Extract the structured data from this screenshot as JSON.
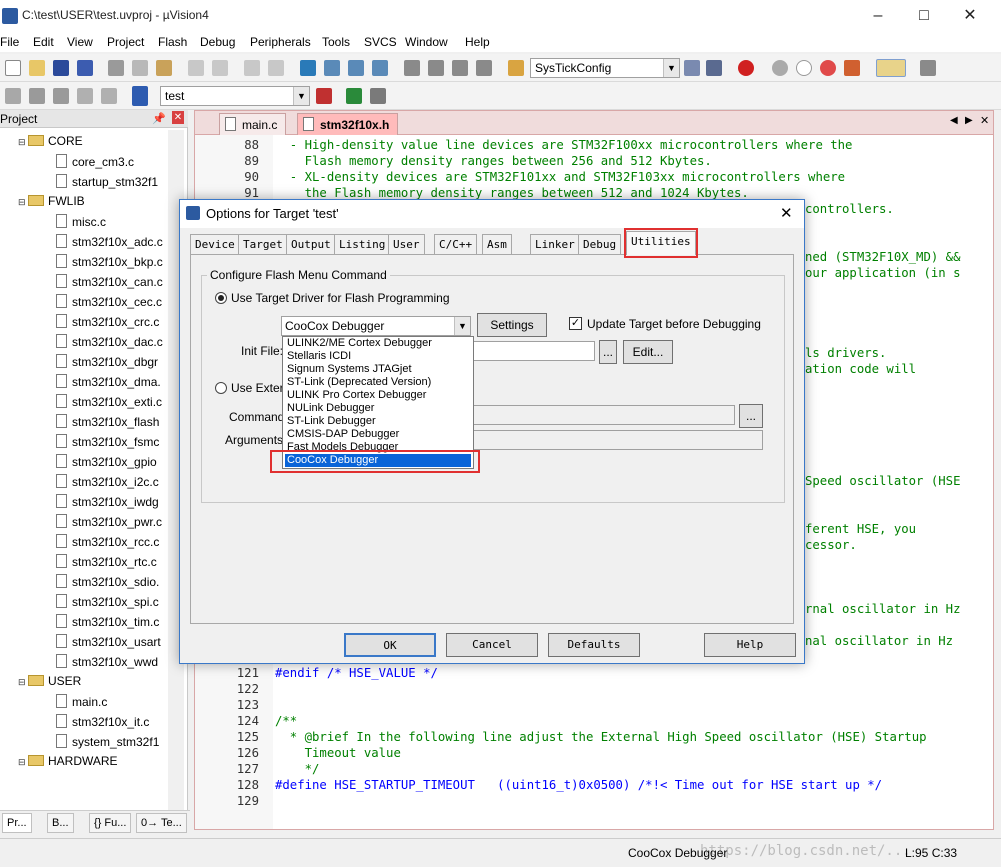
{
  "window": {
    "title": "C:\\test\\USER\\test.uvproj - µVision4"
  },
  "menu": [
    "File",
    "Edit",
    "View",
    "Project",
    "Flash",
    "Debug",
    "Peripherals",
    "Tools",
    "SVCS",
    "Window",
    "Help"
  ],
  "toolbar1": {
    "function_combo": "SysTickConfig"
  },
  "toolbar2": {
    "target_combo": "test"
  },
  "project_panel": {
    "title": "Project",
    "tree": [
      {
        "type": "folder",
        "label": "CORE"
      },
      {
        "type": "file",
        "label": "core_cm3.c"
      },
      {
        "type": "file",
        "label": "startup_stm32f1"
      },
      {
        "type": "folder",
        "label": "FWLIB"
      },
      {
        "type": "file",
        "label": "misc.c"
      },
      {
        "type": "file",
        "label": "stm32f10x_adc.c"
      },
      {
        "type": "file",
        "label": "stm32f10x_bkp.c"
      },
      {
        "type": "file",
        "label": "stm32f10x_can.c"
      },
      {
        "type": "file",
        "label": "stm32f10x_cec.c"
      },
      {
        "type": "file",
        "label": "stm32f10x_crc.c"
      },
      {
        "type": "file",
        "label": "stm32f10x_dac.c"
      },
      {
        "type": "file",
        "label": "stm32f10x_dbgr"
      },
      {
        "type": "file",
        "label": "stm32f10x_dma."
      },
      {
        "type": "file",
        "label": "stm32f10x_exti.c"
      },
      {
        "type": "file",
        "label": "stm32f10x_flash"
      },
      {
        "type": "file",
        "label": "stm32f10x_fsmc"
      },
      {
        "type": "file",
        "label": "stm32f10x_gpio"
      },
      {
        "type": "file",
        "label": "stm32f10x_i2c.c"
      },
      {
        "type": "file",
        "label": "stm32f10x_iwdg"
      },
      {
        "type": "file",
        "label": "stm32f10x_pwr.c"
      },
      {
        "type": "file",
        "label": "stm32f10x_rcc.c"
      },
      {
        "type": "file",
        "label": "stm32f10x_rtc.c"
      },
      {
        "type": "file",
        "label": "stm32f10x_sdio."
      },
      {
        "type": "file",
        "label": "stm32f10x_spi.c"
      },
      {
        "type": "file",
        "label": "stm32f10x_tim.c"
      },
      {
        "type": "file",
        "label": "stm32f10x_usart"
      },
      {
        "type": "file",
        "label": "stm32f10x_wwd"
      },
      {
        "type": "folder",
        "label": "USER"
      },
      {
        "type": "file",
        "label": "main.c"
      },
      {
        "type": "file",
        "label": "stm32f10x_it.c"
      },
      {
        "type": "file",
        "label": "system_stm32f1"
      },
      {
        "type": "folder",
        "label": "HARDWARE"
      }
    ],
    "bottom_tabs": [
      "Pr...",
      "B...",
      "{} Fu...",
      "0→ Te..."
    ]
  },
  "editor": {
    "tabs": [
      {
        "label": "main.c"
      },
      {
        "label": "stm32f10x.h"
      }
    ],
    "lines_top": [
      {
        "n": "88",
        "text": "  - High-density value line devices are STM32F100xx microcontrollers where the"
      },
      {
        "n": "89",
        "text": "    Flash memory density ranges between 256 and 512 Kbytes."
      },
      {
        "n": "90",
        "text": "  - XL-density devices are STM32F101xx and STM32F103xx microcontrollers where"
      },
      {
        "n": "91",
        "text": "    the Flash memory density ranges between 512 and 1024 Kbytes."
      }
    ],
    "right_fragments": [
      {
        "text": "controllers.",
        "row": 0
      },
      {
        "text": "ned (STM32F10X_MD) &&",
        "row": 3
      },
      {
        "text": "our application (in s",
        "row": 4
      },
      {
        "text": "ls drivers.",
        "row": 9
      },
      {
        "text": "ation code will",
        "row": 10
      },
      {
        "text": "Speed oscillator (HSE",
        "row": 17
      },
      {
        "text": "ferent HSE, you",
        "row": 20
      },
      {
        "text": "cessor.",
        "row": 21
      },
      {
        "text": "rnal oscillator in Hz",
        "row": 25
      },
      {
        "text": "nal oscillator in Hz",
        "row": 27
      }
    ],
    "lines_bottom": [
      {
        "n": "121",
        "text": "#endif /* HSE_VALUE */"
      },
      {
        "n": "122",
        "text": ""
      },
      {
        "n": "123",
        "text": ""
      },
      {
        "n": "124",
        "text": "/**"
      },
      {
        "n": "125",
        "text": "  * @brief In the following line adjust the External High Speed oscillator (HSE) Startup"
      },
      {
        "n": "126",
        "text": "    Timeout value"
      },
      {
        "n": "127",
        "text": "    */"
      },
      {
        "n": "128",
        "text": "#define HSE_STARTUP_TIMEOUT   ((uint16_t)0x0500) /*!< Time out for HSE start up */"
      },
      {
        "n": "129",
        "text": ""
      }
    ]
  },
  "status": {
    "debugger": "CooCox Debugger",
    "position": "L:95 C:33"
  },
  "watermark": "https://blog.csdn.net/...",
  "dialog": {
    "title": "Options for Target 'test'",
    "tabs": [
      "Device",
      "Target",
      "Output",
      "Listing",
      "User",
      "C/C++",
      "Asm",
      "Linker",
      "Debug",
      "Utilities"
    ],
    "active_tab": "Utilities",
    "group_label": "Configure Flash Menu Command",
    "radio_target_driver": "Use Target Driver for Flash Programming",
    "radio_external": "Use Extern",
    "selected_driver": "CooCox Debugger",
    "settings_btn": "Settings",
    "update_chk_label": "Update Target before Debugging",
    "init_file_label": "Init File:",
    "browse_btn": "...",
    "edit_btn": "Edit...",
    "command_label": "Command:",
    "arguments_label": "Arguments:",
    "driver_options": [
      "ULINK2/ME Cortex Debugger",
      "Stellaris ICDI",
      "Signum Systems JTAGjet",
      "ST-Link (Deprecated Version)",
      "ULINK Pro Cortex Debugger",
      "NULink Debugger",
      "ST-Link Debugger",
      "CMSIS-DAP Debugger",
      "Fast Models Debugger",
      "CooCox Debugger"
    ],
    "buttons": {
      "ok": "OK",
      "cancel": "Cancel",
      "defaults": "Defaults",
      "help": "Help"
    }
  },
  "colors": {
    "highlight": "#0a64d8",
    "red_annotation": "#e03030",
    "comment": "#008000",
    "keyword": "#0000ff"
  }
}
